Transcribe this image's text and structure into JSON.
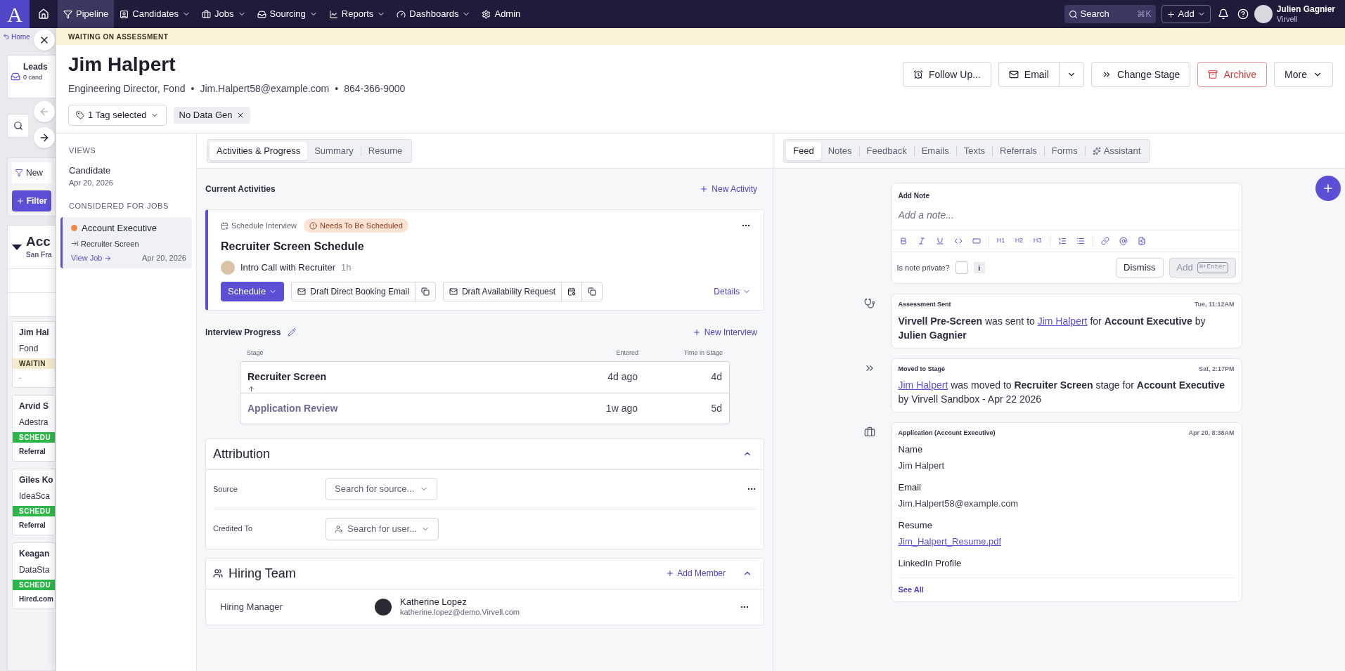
{
  "topnav": {
    "logo": "A",
    "items": [
      {
        "label": "Pipeline",
        "menu": false,
        "selected": true
      },
      {
        "label": "Candidates",
        "menu": true,
        "selected": false
      },
      {
        "label": "Jobs",
        "menu": true,
        "selected": false
      },
      {
        "label": "Sourcing",
        "menu": true,
        "selected": false
      },
      {
        "label": "Reports",
        "menu": true,
        "selected": false
      },
      {
        "label": "Dashboards",
        "menu": true,
        "selected": false
      },
      {
        "label": "Admin",
        "menu": false,
        "selected": false
      }
    ],
    "search": {
      "placeholder": "Search",
      "shortcut": "⌘K"
    },
    "add_button": "Add",
    "user": {
      "name": "Julien Gagnier",
      "org": "Virvell"
    }
  },
  "background_page": {
    "breadcrumb": "Home",
    "leads": {
      "title": "Leads",
      "subtitle": "0 cand"
    },
    "view_tab": "New",
    "filter_button": "Filter",
    "group": {
      "title": "Acc",
      "subtitle": "San Fra"
    },
    "cards": [
      {
        "name": "Jim Hal",
        "company": "Fond",
        "status": "WAITIN",
        "kind": "waiting",
        "source": "-"
      },
      {
        "name": "Arvid S",
        "company": "Adestra",
        "status": "SCHEDU",
        "kind": "scheduled",
        "source": "Referral"
      },
      {
        "name": "Giles Ko",
        "company": "IdeaSca",
        "status": "SCHEDU",
        "kind": "scheduled",
        "source": "Referral"
      },
      {
        "name": "Keagan",
        "company": "DataSta",
        "status": "SCHEDU",
        "kind": "scheduled",
        "source": "Hired.com"
      }
    ]
  },
  "banner": "WAITING ON ASSESSMENT",
  "candidate": {
    "name": "Jim Halpert",
    "title": "Engineering Director, Fond",
    "email": "Jim.Halpert58@example.com",
    "phone": "864-366-9000",
    "separators": [
      "•",
      "•"
    ],
    "tag_select": "1 Tag selected",
    "tags": [
      "No Data Gen"
    ]
  },
  "actions": {
    "follow_up": "Follow Up...",
    "email": "Email",
    "change_stage": "Change Stage",
    "archive": "Archive",
    "more": "More"
  },
  "views": {
    "heading": "VIEWS",
    "candidate": {
      "label": "Candidate",
      "date": "Apr 20, 2026"
    },
    "jobs_heading": "CONSIDERED FOR JOBS",
    "jobs": [
      {
        "title": "Account Executive",
        "color": "#f08a4b",
        "stage": "Recruiter Screen",
        "link": "View Job",
        "date": "Apr 20, 2026",
        "selected": true
      }
    ]
  },
  "middle_tabs": [
    {
      "label": "Activities & Progress",
      "selected": true
    },
    {
      "label": "Summary",
      "selected": false
    },
    {
      "label": "Resume",
      "selected": false
    }
  ],
  "current_activities": {
    "title": "Current Activities",
    "new_button": "New Activity",
    "activity": {
      "type": "Schedule Interview",
      "status": "Needs To Be Scheduled",
      "title": "Recruiter Screen Schedule",
      "event": "Intro Call with Recruiter",
      "duration": "1h",
      "schedule_button": "Schedule",
      "booking_button": "Draft Direct Booking Email",
      "availability_button": "Draft Availability Request",
      "details": "Details"
    }
  },
  "interview_progress": {
    "title": "Interview Progress",
    "new_button": "New Interview",
    "columns": [
      "Stage",
      "Entered",
      "Time in Stage"
    ],
    "rows": [
      {
        "stage": "Recruiter Screen",
        "entered": "4d ago",
        "time": "4d",
        "current": true
      },
      {
        "stage": "Application Review",
        "entered": "1w ago",
        "time": "5d",
        "current": false
      }
    ]
  },
  "attribution": {
    "title": "Attribution",
    "expanded": true,
    "source_label": "Source",
    "source_placeholder": "Search for source...",
    "credited_label": "Credited To",
    "credited_placeholder": "Search for user..."
  },
  "hiring_team": {
    "title": "Hiring Team",
    "add_button": "Add Member",
    "expanded": true,
    "members": [
      {
        "role": "Hiring Manager",
        "name": "Katherine Lopez",
        "email": "katherine.lopez@demo.Virvell.com"
      }
    ]
  },
  "feed_tabs": [
    {
      "label": "Feed",
      "selected": true
    },
    {
      "label": "Notes",
      "selected": false
    },
    {
      "label": "Feedback",
      "selected": false
    },
    {
      "label": "Emails",
      "selected": false
    },
    {
      "label": "Texts",
      "selected": false
    },
    {
      "label": "Referrals",
      "selected": false
    },
    {
      "label": "Forms",
      "selected": false
    },
    {
      "label": "Assistant",
      "selected": false
    }
  ],
  "note": {
    "title": "Add Note",
    "placeholder": "Add a note...",
    "headings": [
      "H1",
      "H2",
      "H3"
    ],
    "private_label": "Is note private?",
    "private": false,
    "info": "i",
    "dismiss": "Dismiss",
    "add": "Add",
    "add_shortcut": "⌘+Enter"
  },
  "feed": [
    {
      "kind": "assessment",
      "title": "Assessment Sent",
      "time": "Tue, 11:12AM",
      "message": [
        {
          "kind": "text",
          "text": "**Virvell Pre-Screen** was sent to"
        },
        {
          "kind": "link",
          "text": "Jim Halpert"
        },
        {
          "kind": "text",
          "text": "for **Account Executive** by **Julien Gagnier**"
        }
      ]
    },
    {
      "kind": "stage",
      "title": "Moved to Stage",
      "time": "Sat, 2:17PM",
      "message": [
        {
          "kind": "link",
          "text": "Jim Halpert"
        },
        {
          "kind": "text",
          "text": "was moved to **Recruiter Screen** stage for **Account Executive** by Virvell Sandbox - Apr 22 2026"
        }
      ]
    },
    {
      "kind": "application",
      "title": "Application (Account Executive)",
      "time": "Apr 20, 8:38AM",
      "fields": [
        {
          "label": "Name",
          "value": "Jim Halpert",
          "kind": "text"
        },
        {
          "label": "Email",
          "value": "Jim.Halpert58@example.com",
          "kind": "text"
        },
        {
          "label": "Resume",
          "value": "Jim_Halpert_Resume.pdf",
          "kind": "link"
        },
        {
          "label": "LinkedIn Profile"
        }
      ],
      "see_all": "See All"
    }
  ]
}
